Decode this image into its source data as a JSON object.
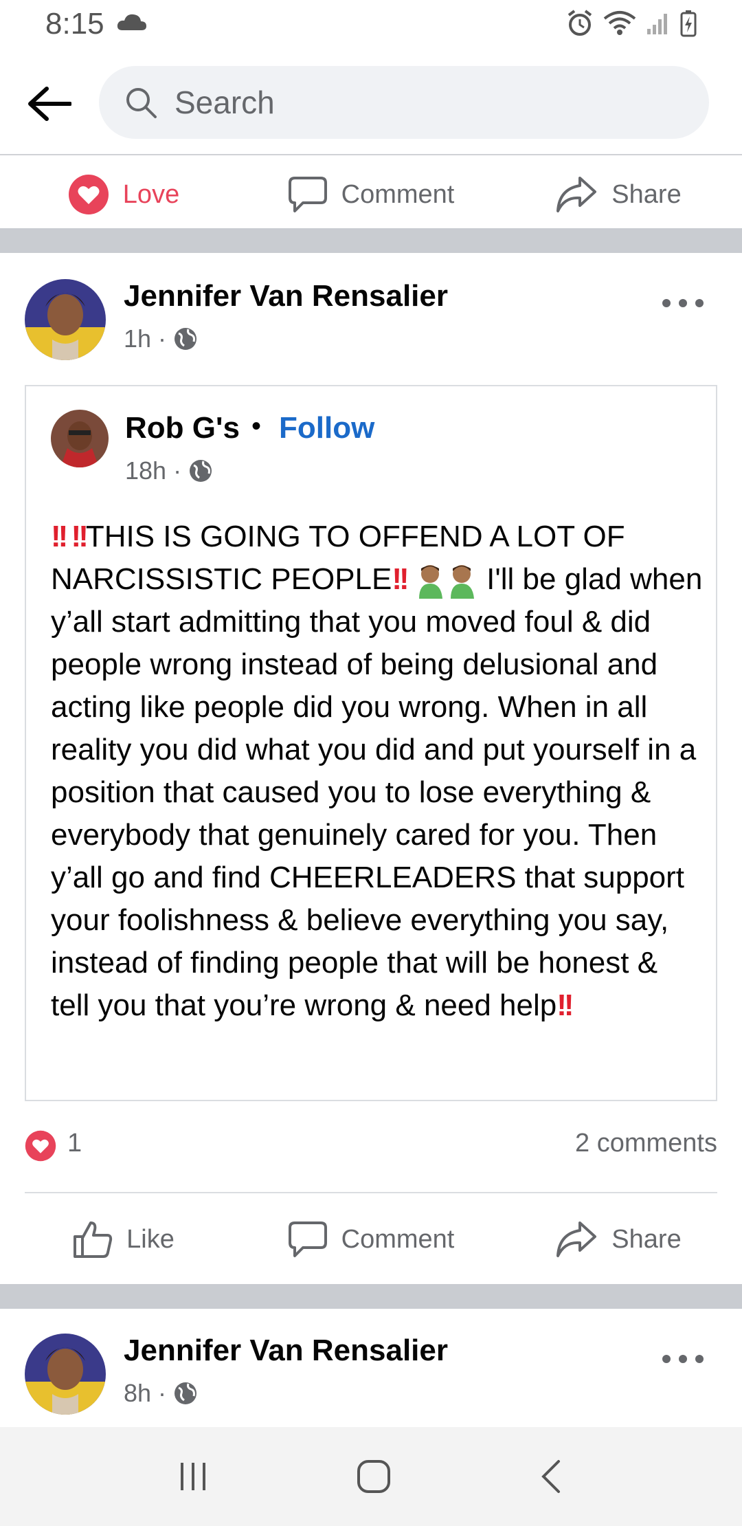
{
  "status_bar": {
    "time": "8:15"
  },
  "search": {
    "placeholder": "Search"
  },
  "top_actions": {
    "love": "Love",
    "comment": "Comment",
    "share": "Share"
  },
  "post": {
    "author": "Jennifer Van Rensalier",
    "time": "1h",
    "shared": {
      "author": "Rob G's",
      "follow": "Follow",
      "time": "18h",
      "text_parts": {
        "p1": "THIS IS GOING TO OFFEND A LOT OF NARCISSISTIC PEOPLE",
        "p2": " I'll be glad when y’all start admitting that you moved foul & did people wrong instead of being delusional and acting like people did you wrong. When in all reality you did what you did and put yourself in a position that caused you to lose everything & everybody that genuinely cared for you. Then y’all go and find CHEERLEADERS that support your foolishness & believe everything you say, instead of finding people that will be honest & tell you that you’re wrong & need help"
      }
    },
    "reaction_count": "1",
    "comments_count": "2 comments",
    "actions": {
      "like": "Like",
      "comment": "Comment",
      "share": "Share"
    }
  },
  "next_post": {
    "author": "Jennifer Van Rensalier",
    "time": "8h"
  },
  "colors": {
    "accent": "#1b6ac9",
    "love": "#e8435a",
    "band": "#c9ccd1"
  }
}
